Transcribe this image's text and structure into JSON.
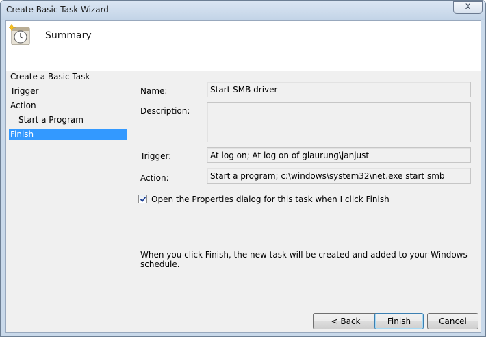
{
  "window": {
    "title": "Create Basic Task Wizard",
    "close_glyph": "x"
  },
  "header": {
    "title": "Summary",
    "icon": "clock-task-icon"
  },
  "steps": [
    {
      "label": "Create a Basic Task",
      "selected": false,
      "indent": false
    },
    {
      "label": "Trigger",
      "selected": false,
      "indent": false
    },
    {
      "label": "Action",
      "selected": false,
      "indent": false
    },
    {
      "label": "Start a Program",
      "selected": false,
      "indent": true
    },
    {
      "label": "Finish",
      "selected": true,
      "indent": false
    }
  ],
  "summary": {
    "name_label": "Name:",
    "name_value": "Start SMB driver",
    "description_label": "Description:",
    "description_value": "",
    "trigger_label": "Trigger:",
    "trigger_value": "At log on; At log on of glaurung\\janjust",
    "action_label": "Action:",
    "action_value": "Start a program; c:\\windows\\system32\\net.exe start smb"
  },
  "open_properties": {
    "label": "Open the Properties dialog for this task when I click Finish",
    "checked": true
  },
  "info_text": "When you click Finish, the new task will be created and added to your Windows schedule.",
  "buttons": {
    "back": "< Back",
    "finish": "Finish",
    "cancel": "Cancel"
  },
  "colors": {
    "selection": "#3399ff",
    "titlebar": "#c9d9ea"
  }
}
